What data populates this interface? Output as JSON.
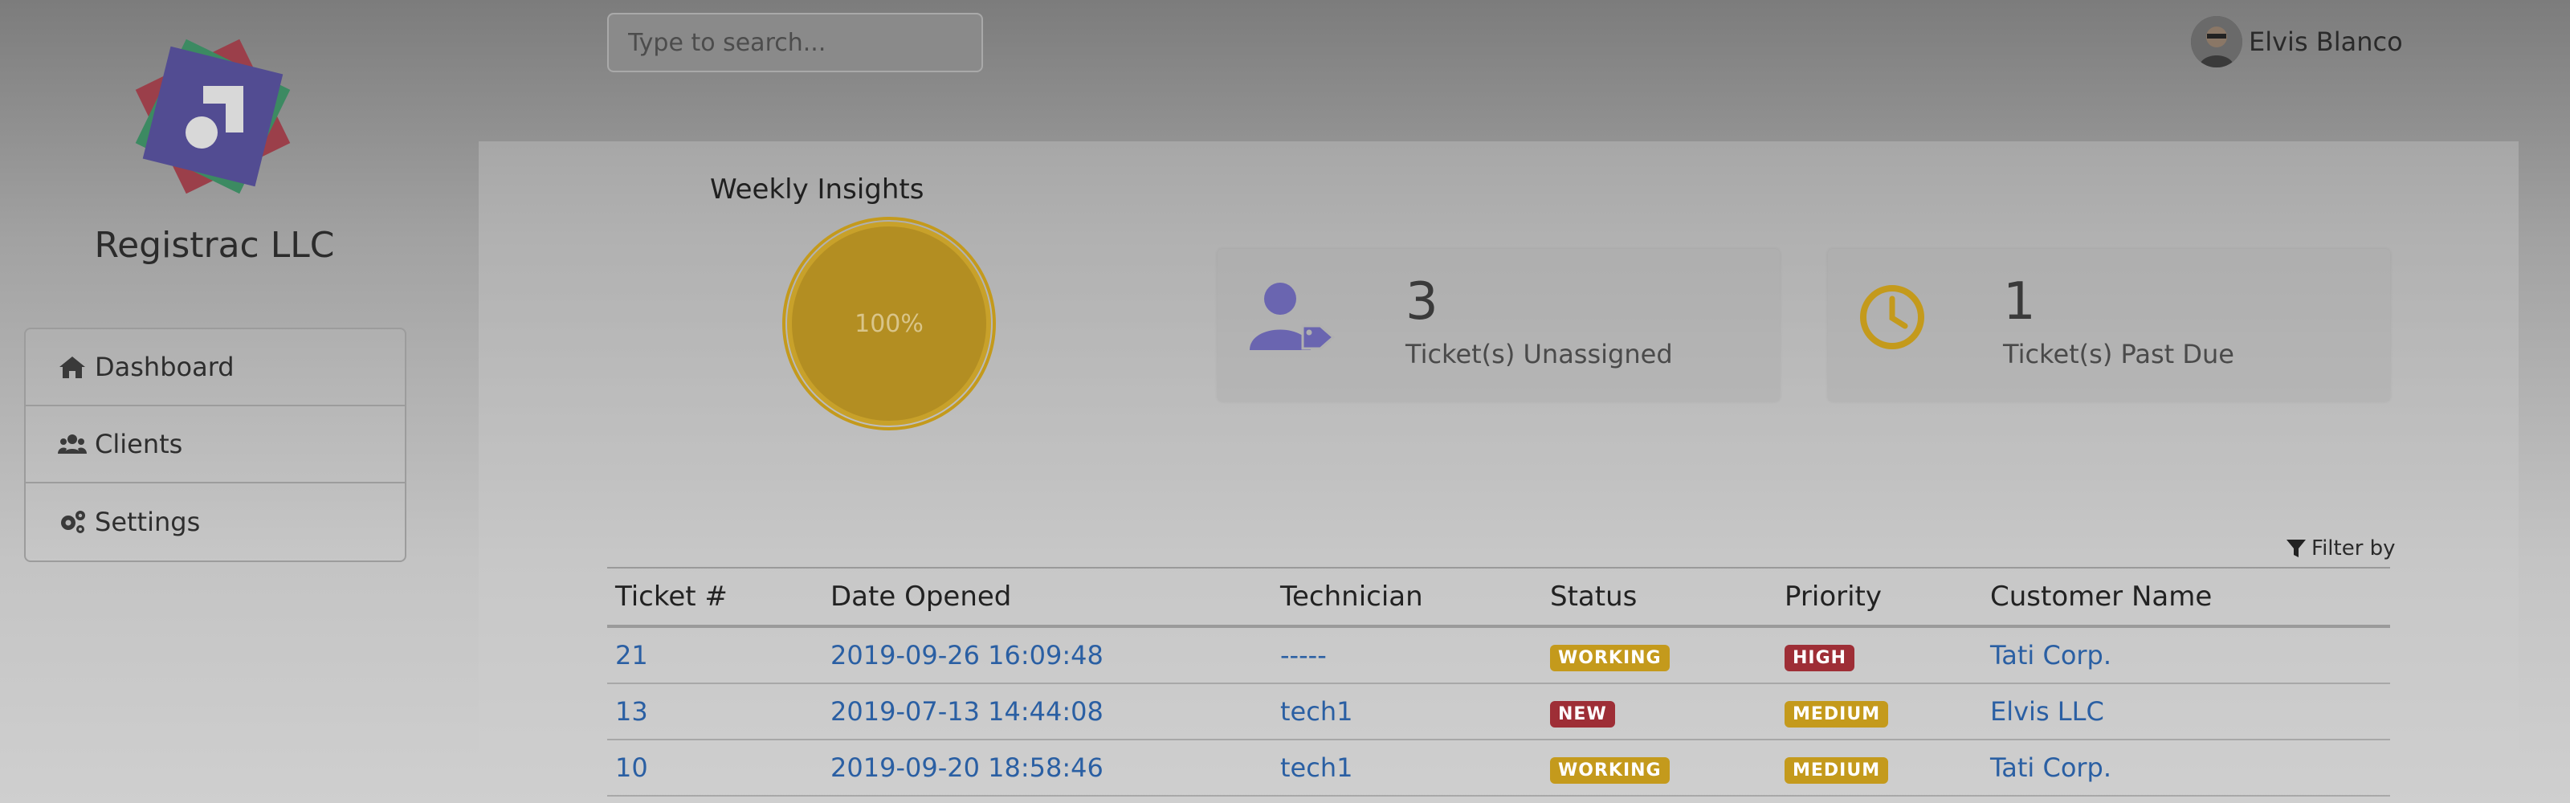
{
  "sidebar": {
    "company": "Registrac LLC",
    "items": [
      {
        "label": "Dashboard",
        "icon": "home-icon"
      },
      {
        "label": "Clients",
        "icon": "users-icon"
      },
      {
        "label": "Settings",
        "icon": "cogs-icon"
      }
    ]
  },
  "topbar": {
    "search_placeholder": "Type to search...",
    "user_name": "Elvis Blanco"
  },
  "insights": {
    "title": "Weekly Insights",
    "gauge_value": "100%",
    "gauge_fraction": 1.0
  },
  "stats": [
    {
      "value": "3",
      "label": "Ticket(s) Unassigned",
      "icon": "user-tag-icon",
      "color": "#6a65b0"
    },
    {
      "value": "1",
      "label": "Ticket(s) Past Due",
      "icon": "clock-icon",
      "color": "#c49a1c"
    }
  ],
  "table": {
    "filter_label": "Filter by",
    "headers": [
      "Ticket #",
      "Date Opened",
      "Technician",
      "Status",
      "Priority",
      "Customer Name"
    ],
    "rows": [
      {
        "ticket": "21",
        "date": "2019-09-26 16:09:48",
        "tech": "-----",
        "status": "WORKING",
        "status_color": "yellow",
        "priority": "HIGH",
        "priority_color": "red",
        "customer": "Tati Corp."
      },
      {
        "ticket": "13",
        "date": "2019-07-13 14:44:08",
        "tech": "tech1",
        "status": "NEW",
        "status_color": "red",
        "priority": "MEDIUM",
        "priority_color": "yellow",
        "customer": "Elvis LLC"
      },
      {
        "ticket": "10",
        "date": "2019-09-20 18:58:46",
        "tech": "tech1",
        "status": "WORKING",
        "status_color": "yellow",
        "priority": "MEDIUM",
        "priority_color": "yellow",
        "customer": "Tati Corp."
      }
    ]
  },
  "colors": {
    "accent": "#6a65b0",
    "warning": "#c49a1c",
    "danger": "#9e2e36",
    "link": "#2a5fa3"
  }
}
